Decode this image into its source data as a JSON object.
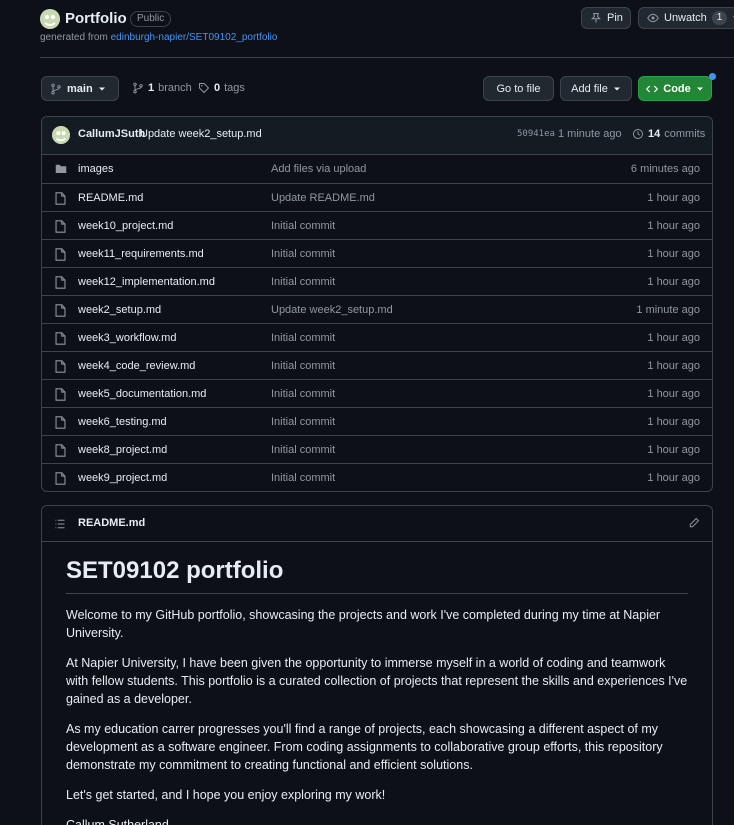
{
  "header": {
    "repo_name": "Portfolio",
    "visibility": "Public",
    "generated_prefix": "generated from",
    "template_link": "edinburgh-napier/SET09102_portfolio",
    "pin_label": "Pin",
    "unwatch_label": "Unwatch",
    "watch_count": "1"
  },
  "toolbar": {
    "branch": "main",
    "branch_count": "1",
    "branch_word": "branch",
    "tag_count": "0",
    "tag_word": "tags",
    "goto_label": "Go to file",
    "addfile_label": "Add file",
    "code_label": "Code"
  },
  "commit": {
    "author": "CallumJSuth",
    "message": "Update week2_setup.md",
    "sha": "50941ea",
    "time": "1 minute ago",
    "count": "14",
    "count_word": "commits"
  },
  "files": [
    {
      "name": "images",
      "msg": "Add files via upload",
      "time": "6 minutes ago",
      "type": "folder"
    },
    {
      "name": "README.md",
      "msg": "Update README.md",
      "time": "1 hour ago",
      "type": "file"
    },
    {
      "name": "week10_project.md",
      "msg": "Initial commit",
      "time": "1 hour ago",
      "type": "file"
    },
    {
      "name": "week11_requirements.md",
      "msg": "Initial commit",
      "time": "1 hour ago",
      "type": "file"
    },
    {
      "name": "week12_implementation.md",
      "msg": "Initial commit",
      "time": "1 hour ago",
      "type": "file"
    },
    {
      "name": "week2_setup.md",
      "msg": "Update week2_setup.md",
      "time": "1 minute ago",
      "type": "file"
    },
    {
      "name": "week3_workflow.md",
      "msg": "Initial commit",
      "time": "1 hour ago",
      "type": "file"
    },
    {
      "name": "week4_code_review.md",
      "msg": "Initial commit",
      "time": "1 hour ago",
      "type": "file"
    },
    {
      "name": "week5_documentation.md",
      "msg": "Initial commit",
      "time": "1 hour ago",
      "type": "file"
    },
    {
      "name": "week6_testing.md",
      "msg": "Initial commit",
      "time": "1 hour ago",
      "type": "file"
    },
    {
      "name": "week8_project.md",
      "msg": "Initial commit",
      "time": "1 hour ago",
      "type": "file"
    },
    {
      "name": "week9_project.md",
      "msg": "Initial commit",
      "time": "1 hour ago",
      "type": "file"
    }
  ],
  "readme": {
    "file_label": "README.md",
    "heading": "SET09102 portfolio",
    "paragraphs": [
      "Welcome to my GitHub portfolio, showcasing the projects and work I've completed during my time at Napier University.",
      "At Napier University, I have been given the opportunity to immerse myself in a world of coding and teamwork with fellow students. This portfolio is a curated collection of projects that represent the skills and experiences I've gained as a developer.",
      "As my education carrer progresses you'll find a range of projects, each showcasing a different aspect of my development as a software engineer. From coding assignments to collaborative group efforts, this repository demonstrate my commitment to creating functional and efficient solutions.",
      "Let's get started, and I hope you enjoy exploring my work!",
      "Callum Sutherland"
    ]
  },
  "colors": {
    "background": "#0d1117",
    "border": "#3d444d",
    "link": "#4493f8",
    "code_button": "#238636",
    "muted_text": "#9198a1"
  }
}
